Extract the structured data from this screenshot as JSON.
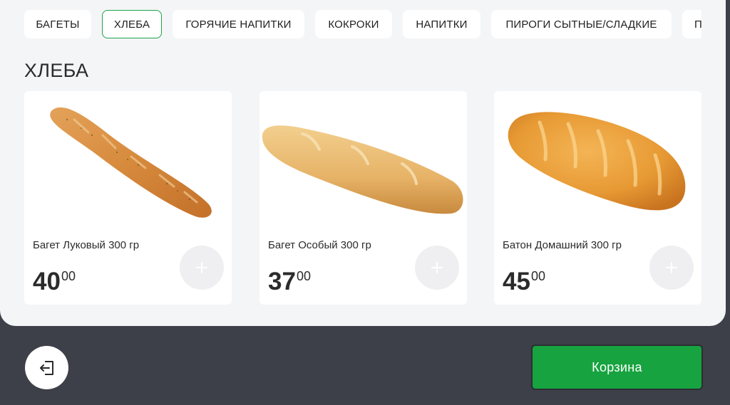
{
  "categories": [
    {
      "label": "БАГЕТЫ",
      "active": false
    },
    {
      "label": "ХЛЕБА",
      "active": true
    },
    {
      "label": "ГОРЯЧИЕ НАПИТКИ",
      "active": false
    },
    {
      "label": "КОКРОКИ",
      "active": false
    },
    {
      "label": "НАПИТКИ",
      "active": false
    },
    {
      "label": "ПИРОГИ СЫТНЫЕ/СЛАДКИЕ",
      "active": false
    },
    {
      "label": "П",
      "active": false
    }
  ],
  "section_title": "ХЛЕБА",
  "products": [
    {
      "name": "Багет Луковый 300 гр",
      "price_int": "40",
      "price_frac": "00",
      "add_icon": "plus-icon"
    },
    {
      "name": "Багет Особый 300 гр",
      "price_int": "37",
      "price_frac": "00",
      "add_icon": "plus-icon"
    },
    {
      "name": "Батон Домашний 300 гр",
      "price_int": "45",
      "price_frac": "00",
      "add_icon": "plus-icon"
    }
  ],
  "footer": {
    "exit_icon": "logout-icon",
    "cart_label": "Корзина"
  },
  "colors": {
    "accent": "#17a33f",
    "footer_bg": "#3d4048",
    "panel_bg": "#f4f5f7"
  }
}
